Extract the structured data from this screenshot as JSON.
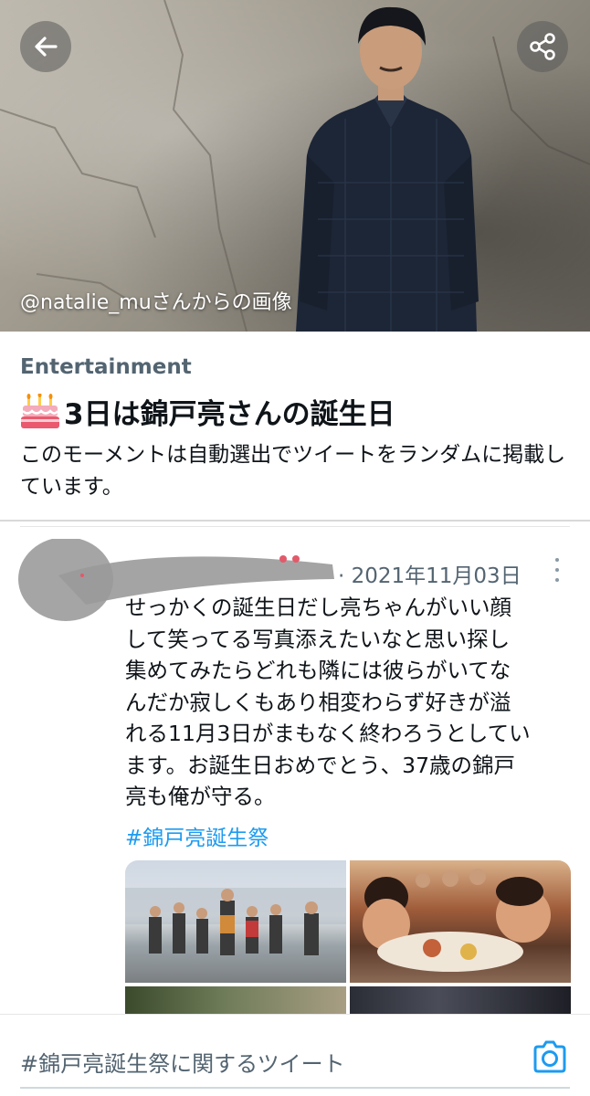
{
  "hero": {
    "credit": "@natalie_muさんからの画像",
    "icons": {
      "back": "arrow-left-icon",
      "share": "share-icon"
    }
  },
  "moment": {
    "category": "Entertainment",
    "title_emoji": "birthday-cake-icon",
    "title": "3日は錦戸亮さんの誕生日",
    "description": "このモーメントは自動選出でツイートをランダムに掲載しています。"
  },
  "tweet": {
    "date": "· 2021年11月03日",
    "lines": [
      "せっかくの誕生日だし亮ちゃんがいい顔",
      "して笑ってる写真添えたいなと思い探し",
      "集めてみたらどれも隣には彼らがいてな",
      "んだか寂しくもあり相変わらず好きが溢",
      "れる11月3日がまもなく終わろうとしてい",
      "ます。お誕生日おめでとう、37歳の錦戸",
      "亮も俺が守る。"
    ],
    "hashtag": "#錦戸亮誕生祭",
    "more_icon": "more-vertical-icon"
  },
  "bottom": {
    "text": "#錦戸亮誕生祭に関するツイート",
    "camera_icon": "camera-icon"
  },
  "colors": {
    "link": "#1d9bf0",
    "secondary_text": "#536471",
    "primary_text": "#0f1419"
  }
}
